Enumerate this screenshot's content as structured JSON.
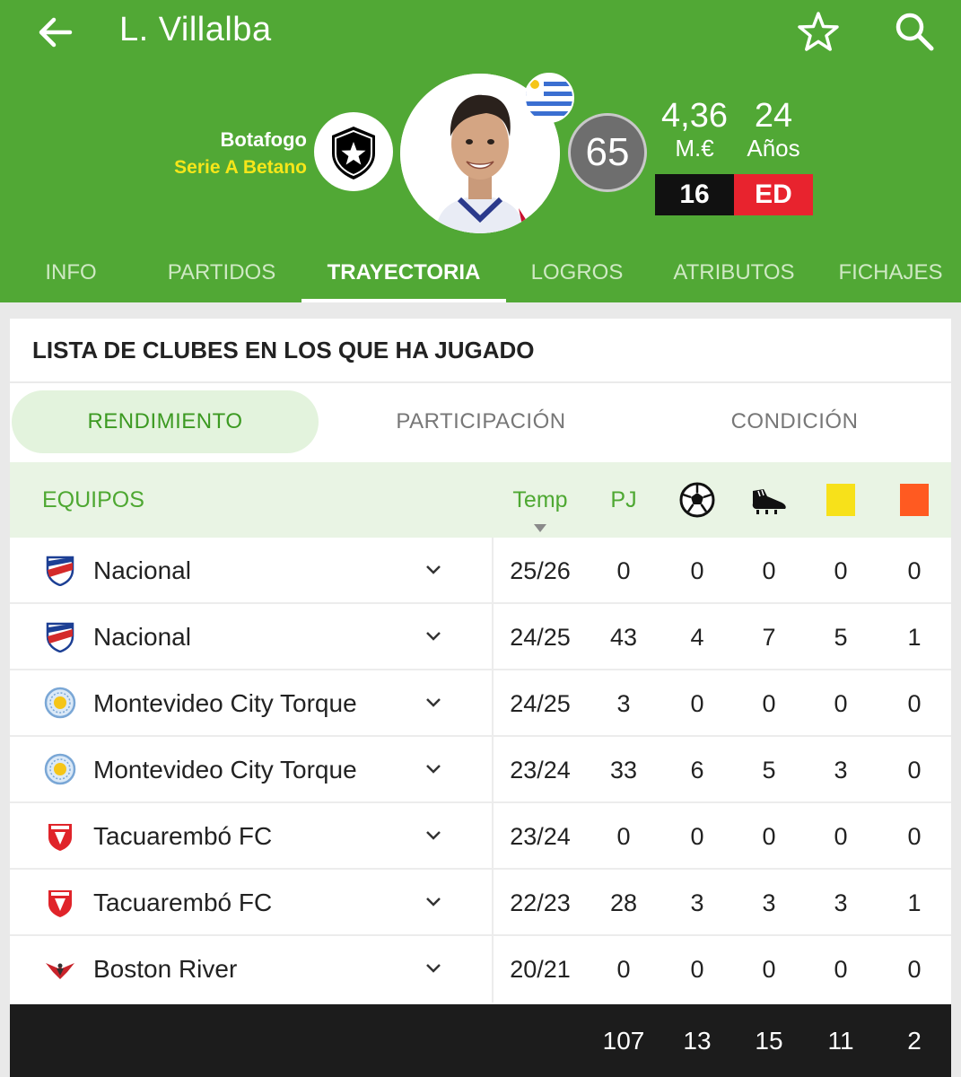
{
  "header": {
    "player_name": "L. Villalba",
    "club": "Botafogo",
    "league": "Serie A Betano",
    "rating": "65",
    "market_value": "4,36",
    "market_value_unit": "M.€",
    "age": "24",
    "age_unit": "Años",
    "shirt_number": "16",
    "position": "ED",
    "colors": {
      "header_bg": "#51a835",
      "position_bg": "#e8232e",
      "shirt_bg": "#111111",
      "league_text": "#f5e61a"
    }
  },
  "icons": {
    "back": "arrow-left-icon",
    "favorite": "star-icon",
    "search": "search-icon"
  },
  "tabs": [
    {
      "label": "INFO"
    },
    {
      "label": "PARTIDOS"
    },
    {
      "label": "TRAYECTORIA",
      "active": true
    },
    {
      "label": "LOGROS"
    },
    {
      "label": "ATRIBUTOS"
    },
    {
      "label": "FICHAJES"
    }
  ],
  "card": {
    "title": "LISTA DE CLUBES EN LOS QUE HA JUGADO",
    "subtabs": [
      {
        "label": "RENDIMIENTO",
        "active": true
      },
      {
        "label": "PARTICIPACIÓN"
      },
      {
        "label": "CONDICIÓN"
      }
    ],
    "columns": {
      "team": "EQUIPOS",
      "season": "Temp",
      "played": "PJ",
      "goals_icon": "soccer-ball-icon",
      "assists_icon": "boot-icon",
      "yellow_icon": "yellow-card-icon",
      "red_icon": "red-card-icon"
    },
    "rows": [
      {
        "team": "Nacional",
        "crest": "nacional",
        "season": "25/26",
        "pj": "0",
        "goals": "0",
        "assists": "0",
        "yellow": "0",
        "red": "0"
      },
      {
        "team": "Nacional",
        "crest": "nacional",
        "season": "24/25",
        "pj": "43",
        "goals": "4",
        "assists": "7",
        "yellow": "5",
        "red": "1"
      },
      {
        "team": "Montevideo City Torque",
        "crest": "mct",
        "season": "24/25",
        "pj": "3",
        "goals": "0",
        "assists": "0",
        "yellow": "0",
        "red": "0"
      },
      {
        "team": "Montevideo City Torque",
        "crest": "mct",
        "season": "23/24",
        "pj": "33",
        "goals": "6",
        "assists": "5",
        "yellow": "3",
        "red": "0"
      },
      {
        "team": "Tacuarembó FC",
        "crest": "tfc",
        "season": "23/24",
        "pj": "0",
        "goals": "0",
        "assists": "0",
        "yellow": "0",
        "red": "0"
      },
      {
        "team": "Tacuarembó FC",
        "crest": "tfc",
        "season": "22/23",
        "pj": "28",
        "goals": "3",
        "assists": "3",
        "yellow": "3",
        "red": "1"
      },
      {
        "team": "Boston River",
        "crest": "boston",
        "season": "20/21",
        "pj": "0",
        "goals": "0",
        "assists": "0",
        "yellow": "0",
        "red": "0"
      }
    ],
    "totals": {
      "pj": "107",
      "goals": "13",
      "assists": "15",
      "yellow": "11",
      "red": "2"
    }
  }
}
